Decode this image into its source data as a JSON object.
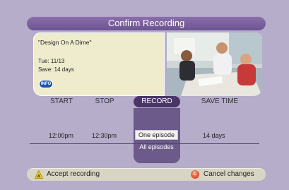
{
  "header": {
    "title": "Confirm Recording"
  },
  "program": {
    "title": "\"Design On A Dime\"",
    "date": "Tue:  11/13",
    "save": "Save:  14 days",
    "info_label": "INFO"
  },
  "columns": {
    "start": "START",
    "stop": "STOP",
    "record": "RECORD",
    "save_time": "SAVE TIME"
  },
  "values": {
    "start": "12:00pm",
    "stop": "12:30pm",
    "save_time": "14 days"
  },
  "record_options": {
    "selected": "One episode",
    "other": "All episodes"
  },
  "footer": {
    "accept_key": "A",
    "accept_label": "Accept recording",
    "cancel_key": "C",
    "cancel_label": "Cancel changes"
  },
  "colors": {
    "background": "#b5adc9",
    "title_bar": "#7a5f9e",
    "record_highlight": "#4a3568",
    "info_panel": "#eeeccd",
    "accept_key": "#f2d21b",
    "cancel_key": "#d9461e"
  }
}
